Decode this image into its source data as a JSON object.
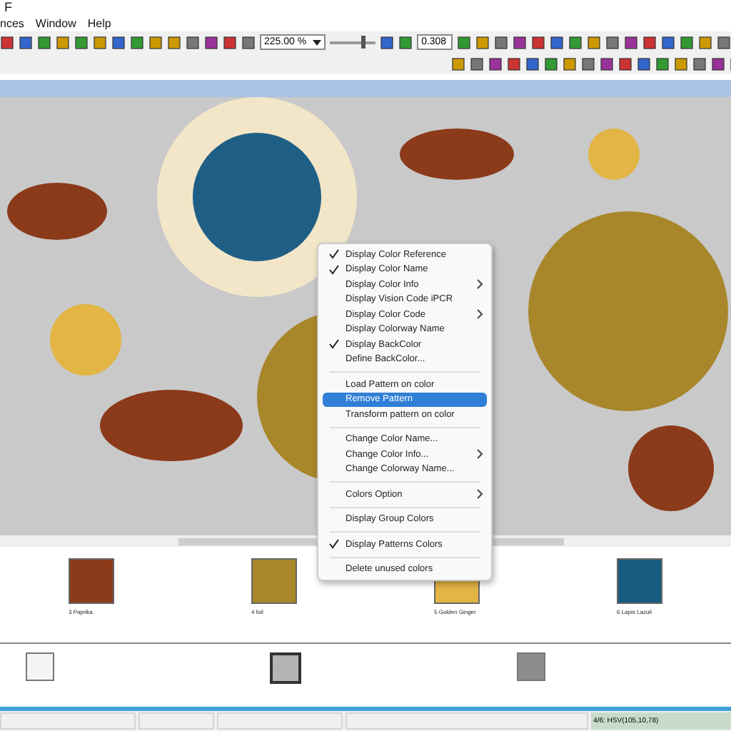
{
  "window": {
    "title": "F"
  },
  "menu_bar": [
    "nces",
    "Window",
    "Help"
  ],
  "toolbar": {
    "zoom": "225.00 %",
    "zoom_slider": {
      "level": 0.72
    },
    "value": "0.308"
  },
  "palette": [
    {
      "name": "3 Paprika",
      "color": "#8b3a1a"
    },
    {
      "name": "4 foil",
      "color": "#a8862a"
    },
    {
      "name": "5 Golden Ginger",
      "color": "#e2b544"
    },
    {
      "name": "6 Lapis Lazuli",
      "color": "#175b80"
    }
  ],
  "base_colors": [
    {
      "color": "#f4f4f4",
      "selected": false
    },
    {
      "color": "#b4b4b4",
      "selected": true
    },
    {
      "color": "#8c8c8c",
      "selected": false
    }
  ],
  "context_menu": [
    {
      "kind": "item",
      "label": "Display Color Reference",
      "checked": true,
      "submenu": false,
      "selected": false
    },
    {
      "kind": "item",
      "label": "Display Color Name",
      "checked": true,
      "submenu": false,
      "selected": false
    },
    {
      "kind": "item",
      "label": "Display Color Info",
      "checked": false,
      "submenu": true,
      "selected": false
    },
    {
      "kind": "item",
      "label": "Display Vision Code iPCR",
      "checked": false,
      "submenu": false,
      "selected": false
    },
    {
      "kind": "item",
      "label": "Display Color Code",
      "checked": false,
      "submenu": true,
      "selected": false
    },
    {
      "kind": "item",
      "label": "Display Colorway Name",
      "checked": false,
      "submenu": false,
      "selected": false
    },
    {
      "kind": "item",
      "label": "Display BackColor",
      "checked": true,
      "submenu": false,
      "selected": false
    },
    {
      "kind": "item",
      "label": "Define BackColor...",
      "checked": false,
      "submenu": false,
      "selected": false
    },
    {
      "kind": "separator"
    },
    {
      "kind": "item",
      "label": "Load Pattern on color",
      "checked": false,
      "submenu": false,
      "selected": false
    },
    {
      "kind": "item",
      "label": "Remove Pattern",
      "checked": false,
      "submenu": false,
      "selected": true
    },
    {
      "kind": "item",
      "label": "Transform pattern on color",
      "checked": false,
      "submenu": false,
      "selected": false
    },
    {
      "kind": "separator"
    },
    {
      "kind": "item",
      "label": "Change Color Name...",
      "checked": false,
      "submenu": false,
      "selected": false
    },
    {
      "kind": "item",
      "label": "Change Color Info...",
      "checked": false,
      "submenu": true,
      "selected": false
    },
    {
      "kind": "item",
      "label": "Change Colorway Name...",
      "checked": false,
      "submenu": false,
      "selected": false
    },
    {
      "kind": "separator"
    },
    {
      "kind": "item",
      "label": "Colors Option",
      "checked": false,
      "submenu": true,
      "selected": false
    },
    {
      "kind": "separator"
    },
    {
      "kind": "item",
      "label": "Display Group Colors",
      "checked": false,
      "submenu": false,
      "selected": false
    },
    {
      "kind": "separator"
    },
    {
      "kind": "item",
      "label": "Display Patterns Colors",
      "checked": true,
      "submenu": false,
      "selected": false
    },
    {
      "kind": "separator"
    },
    {
      "kind": "item",
      "label": "Delete unused colors",
      "checked": false,
      "submenu": false,
      "selected": false
    }
  ],
  "status_bar": {
    "color_info": "4/6: HSV(105,10,78)"
  }
}
